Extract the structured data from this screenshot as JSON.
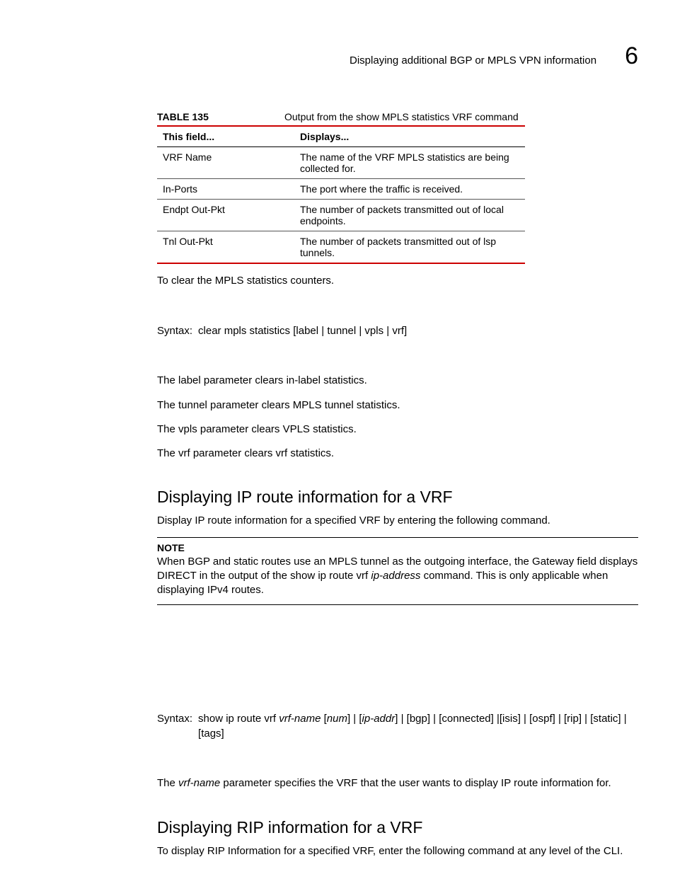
{
  "header": {
    "running_title": "Displaying additional BGP or MPLS VPN information",
    "chapter_number": "6"
  },
  "table135": {
    "label": "TABLE 135",
    "caption": "Output from the show MPLS statistics VRF command",
    "head_field": "This field...",
    "head_displays": "Displays...",
    "rows": [
      {
        "field": "VRF Name",
        "desc": "The name of the VRF MPLS statistics are being collected for."
      },
      {
        "field": "In-Ports",
        "desc": "The port where the traffic is received."
      },
      {
        "field": "Endpt Out-Pkt",
        "desc": "The number of packets transmitted out of local endpoints."
      },
      {
        "field": "Tnl Out-Pkt",
        "desc": "The number of packets transmitted out of lsp tunnels."
      }
    ]
  },
  "clear_intro": "To clear the MPLS statistics counters.",
  "clear_syntax_label": "Syntax:",
  "clear_syntax_body": "clear mpls statistics [label | tunnel | vpls | vrf]",
  "clear_p_label": "The label parameter clears in-label statistics.",
  "clear_p_tunnel": "The tunnel parameter clears MPLS tunnel statistics.",
  "clear_p_vpls": "The vpls parameter clears VPLS statistics.",
  "clear_p_vrf": "The vrf parameter clears vrf statistics.",
  "sec_iproute": {
    "heading": "Displaying IP route information for a VRF",
    "intro": "Display IP route information for a specified VRF by entering the following command."
  },
  "note": {
    "label": "NOTE",
    "body_pre": "When BGP and static routes use an MPLS tunnel as the outgoing interface, the Gateway field displays DIRECT in the output of the show ip route vrf ",
    "body_ital": "ip-address",
    "body_post": " command. This is only applicable when displaying IPv4 routes."
  },
  "show_syntax": {
    "label": "Syntax: ",
    "prefix": "show ip route vrf ",
    "vrfname": "vrf-name",
    "after_vrf": " [",
    "num": "num",
    "mid1": "] | [",
    "ipaddr": "ip-addr",
    "mid2": "] | [bgp] | [connected] |[isis] | [ospf] | [rip] | [static] | [tags]"
  },
  "vrf_param_sentence": {
    "pre": "The ",
    "ital": "vrf-name",
    "post": " parameter specifies the VRF that the user wants to display IP route information for."
  },
  "sec_rip": {
    "heading": "Displaying RIP information for a VRF",
    "intro": "To display RIP Information for a specified VRF, enter the following command at any level of the CLI."
  }
}
